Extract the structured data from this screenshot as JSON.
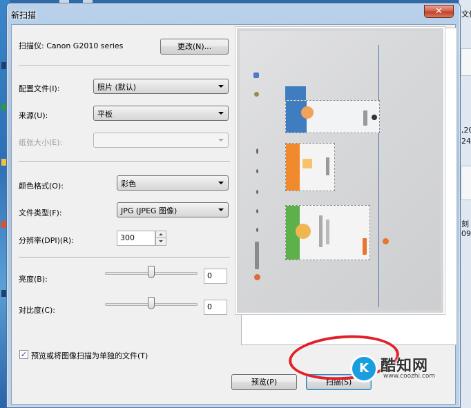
{
  "window": {
    "title": "新扫描",
    "close_glyph": "✕"
  },
  "scanner": {
    "label": "扫描仪: Canon G2010 series",
    "change_button": "更改(N)..."
  },
  "settings": {
    "profile": {
      "label": "配置文件(I):",
      "value": "照片 (默认)"
    },
    "source": {
      "label": "来源(U):",
      "value": "平板"
    },
    "paper_size": {
      "label": "纸张大小(E):",
      "value": "",
      "enabled": false
    },
    "color_format": {
      "label": "颜色格式(O):",
      "value": "彩色"
    },
    "file_type": {
      "label": "文件类型(F):",
      "value": "JPG (JPEG 图像)"
    },
    "resolution": {
      "label": "分辨率(DPI)(R):",
      "value": "300"
    },
    "brightness": {
      "label": "亮度(B):",
      "value": "0",
      "slider_fraction": 0.5
    },
    "contrast": {
      "label": "对比度(C):",
      "value": "0",
      "slider_fraction": 0.5
    },
    "separate_files": {
      "label": "预览或将图像扫描为单独的文件(T)",
      "checked": true,
      "check_glyph": "✓"
    }
  },
  "buttons": {
    "preview": "预览(P)",
    "scan": "扫描(S)"
  },
  "watermark": {
    "logo_text": "K",
    "name": "酷知网",
    "url": "www.coozhi.com"
  },
  "desktop_right_fragments": [
    "文件",
    ",20",
    "24",
    "刻",
    "09"
  ],
  "colors": {
    "accent_red_oval": "#e2202a",
    "card_blue": "#3f7dc0",
    "card_orange": "#f08a2c",
    "card_green": "#5db04a"
  }
}
